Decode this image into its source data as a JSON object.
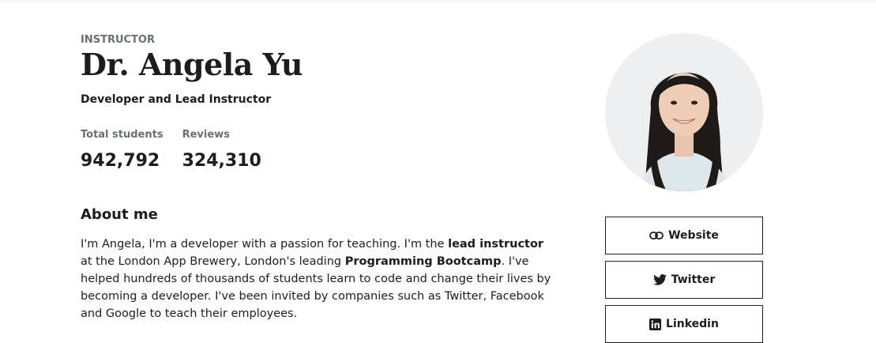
{
  "profile": {
    "eyebrow": "INSTRUCTOR",
    "name": "Dr. Angela Yu",
    "headline": "Developer and Lead Instructor",
    "avatar_icon": "instructor-avatar-photo"
  },
  "stats": [
    {
      "label": "Total students",
      "value": "942,792"
    },
    {
      "label": "Reviews",
      "value": "324,310"
    }
  ],
  "about": {
    "title": "About me",
    "p1": "I'm Angela, I'm a developer with a passion for teaching. I'm the ",
    "b1": "lead instructor",
    "p2": " at the London App Brewery, London's leading ",
    "b2": "Programming Bootcamp",
    "p3": ". I've helped hundreds of thousands of students learn to code and change their lives by becoming a developer. I've been invited by companies such as Twitter, Facebook and Google to teach their employees."
  },
  "links": [
    {
      "label": "Website",
      "icon": "link-icon"
    },
    {
      "label": "Twitter",
      "icon": "twitter-icon"
    },
    {
      "label": "Linkedin",
      "icon": "linkedin-icon"
    }
  ]
}
